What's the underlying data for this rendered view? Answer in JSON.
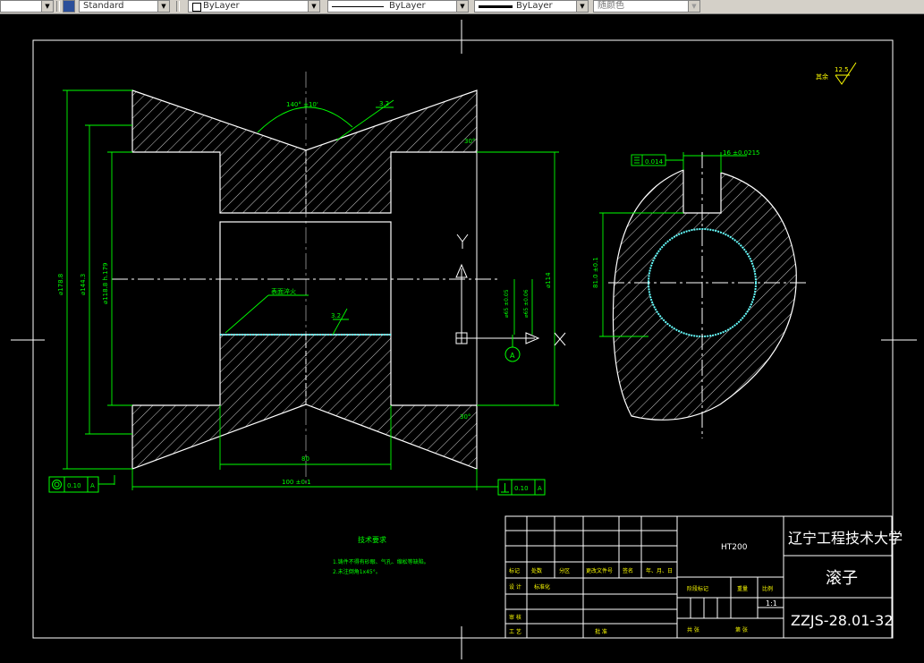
{
  "toolbar": {
    "plot_style": "Standard",
    "layer": "ByLayer",
    "linetype": "ByLayer",
    "lineweight": "ByLayer",
    "color": "随颜色"
  },
  "drawing": {
    "dims": {
      "angle_140": "140° ±10'",
      "rough_32_top": "3.2",
      "angle_30_top": "30°",
      "angle_30_bottom": "30°",
      "dia_178": "⌀178.8",
      "dia_144": "⌀144.3",
      "dia_118": "⌀118.8 h.179",
      "dia_114": "⌀114",
      "dia_65a": "⌀65 ±0.05",
      "dia_65b": "⌀65 ±0.06",
      "len_80": "80",
      "len_100": "100 ±0.1",
      "surface_note": "表面淬火",
      "rough_32_bore": "3.2",
      "axis_y": "Y",
      "axis_x": "X",
      "datum_a": "A",
      "gtol_left_val": "0.10",
      "gtol_left_ref": "A",
      "gtol_right_val": "0.10",
      "gtol_right_ref": "A",
      "roughness_rest_label": "其余",
      "roughness_rest_val": "12.5",
      "keyway_width": "16 ±0.0215",
      "keyway_sym": "0.014",
      "keyway_depth": "81.0 ±0.1"
    },
    "notes": {
      "title": "技术要求",
      "line1": "1.铸件不得有砂眼、气孔、缩松等缺陷。",
      "line2": "2.未注倒角1x45°。"
    },
    "title_block": {
      "university": "辽宁工程技术大学",
      "part_name": "滚子",
      "material": "HT200",
      "drawing_no": "ZZJS-28.01-32",
      "scale": "1:1",
      "hdr_mark": "标记",
      "hdr_count": "处数",
      "hdr_zone": "分区",
      "hdr_doc": "更改文件号",
      "hdr_sign": "签名",
      "hdr_date": "年、月、日",
      "row_design": "设 计",
      "row_design_b": "标准化",
      "row_review": "审 核",
      "row_process": "工 艺",
      "row_approve": "批 准",
      "stage_mark": "阶段标记",
      "weight": "重量",
      "ratio": "比例",
      "sheet_total": "共  张",
      "sheet_no": "第  张"
    }
  }
}
